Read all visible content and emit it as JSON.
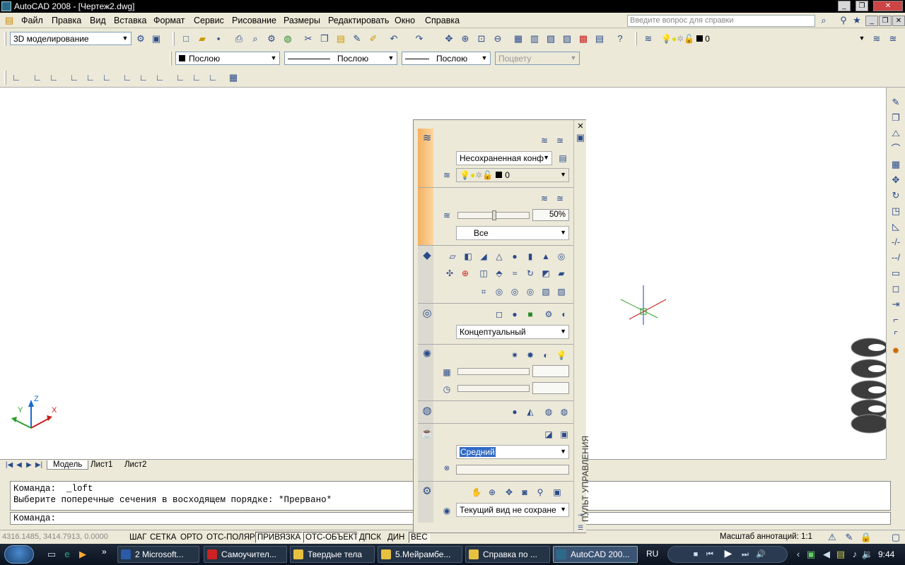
{
  "window": {
    "title": "AutoCAD 2008 - [Чертеж2.dwg]"
  },
  "menu": [
    "Файл",
    "Правка",
    "Вид",
    "Вставка",
    "Формат",
    "Сервис",
    "Рисование",
    "Размеры",
    "Редактировать",
    "Окно",
    "Справка"
  ],
  "help_placeholder": "Введите вопрос для справки",
  "workspace": "3D моделирование",
  "layer_value": "0",
  "properties": {
    "color": "Послою",
    "linetype": "Послою",
    "lineweight": "Послою",
    "plotstyle": "Поцвету"
  },
  "layout_tabs": [
    "Модель",
    "Лист1",
    "Лист2"
  ],
  "command": {
    "line1": "Команда:  _loft",
    "line2": "Выберите поперечные сечения в восходящем порядке: *Прервано*",
    "prompt": "Команда:"
  },
  "status": {
    "coords": "4316.1485, 3414.7913, 0.0000",
    "buttons": [
      "ШАГ",
      "СЕТКА",
      "ОРТО",
      "ОТС-ПОЛЯР",
      "ПРИВЯЗКА",
      "ОТС-ОБЪЕКТ",
      "ДПСК",
      "ДИН",
      "ВЕС"
    ],
    "annotation_scale_label": "Масштаб аннотаций:",
    "annotation_scale": "1:1"
  },
  "panel": {
    "title": "ПУЛЬТ УПРАВЛЕНИЯ",
    "layer_state": "Несохраненная конф",
    "layer_current": "0",
    "fade_percent": "50%",
    "fade_percent_value": 0.5,
    "fade_filter": "Все",
    "visual_style": "Концептуальный",
    "render_quality": "Средний",
    "view": "Текущий вид не сохране"
  },
  "taskbar": {
    "buttons": [
      "2 Microsoft...",
      "Самоучител...",
      "Твердые тела",
      "5.Мейрамбе...",
      "Справка по ...",
      "AutoCAD 200..."
    ],
    "lang": "RU",
    "time": "9:44"
  }
}
